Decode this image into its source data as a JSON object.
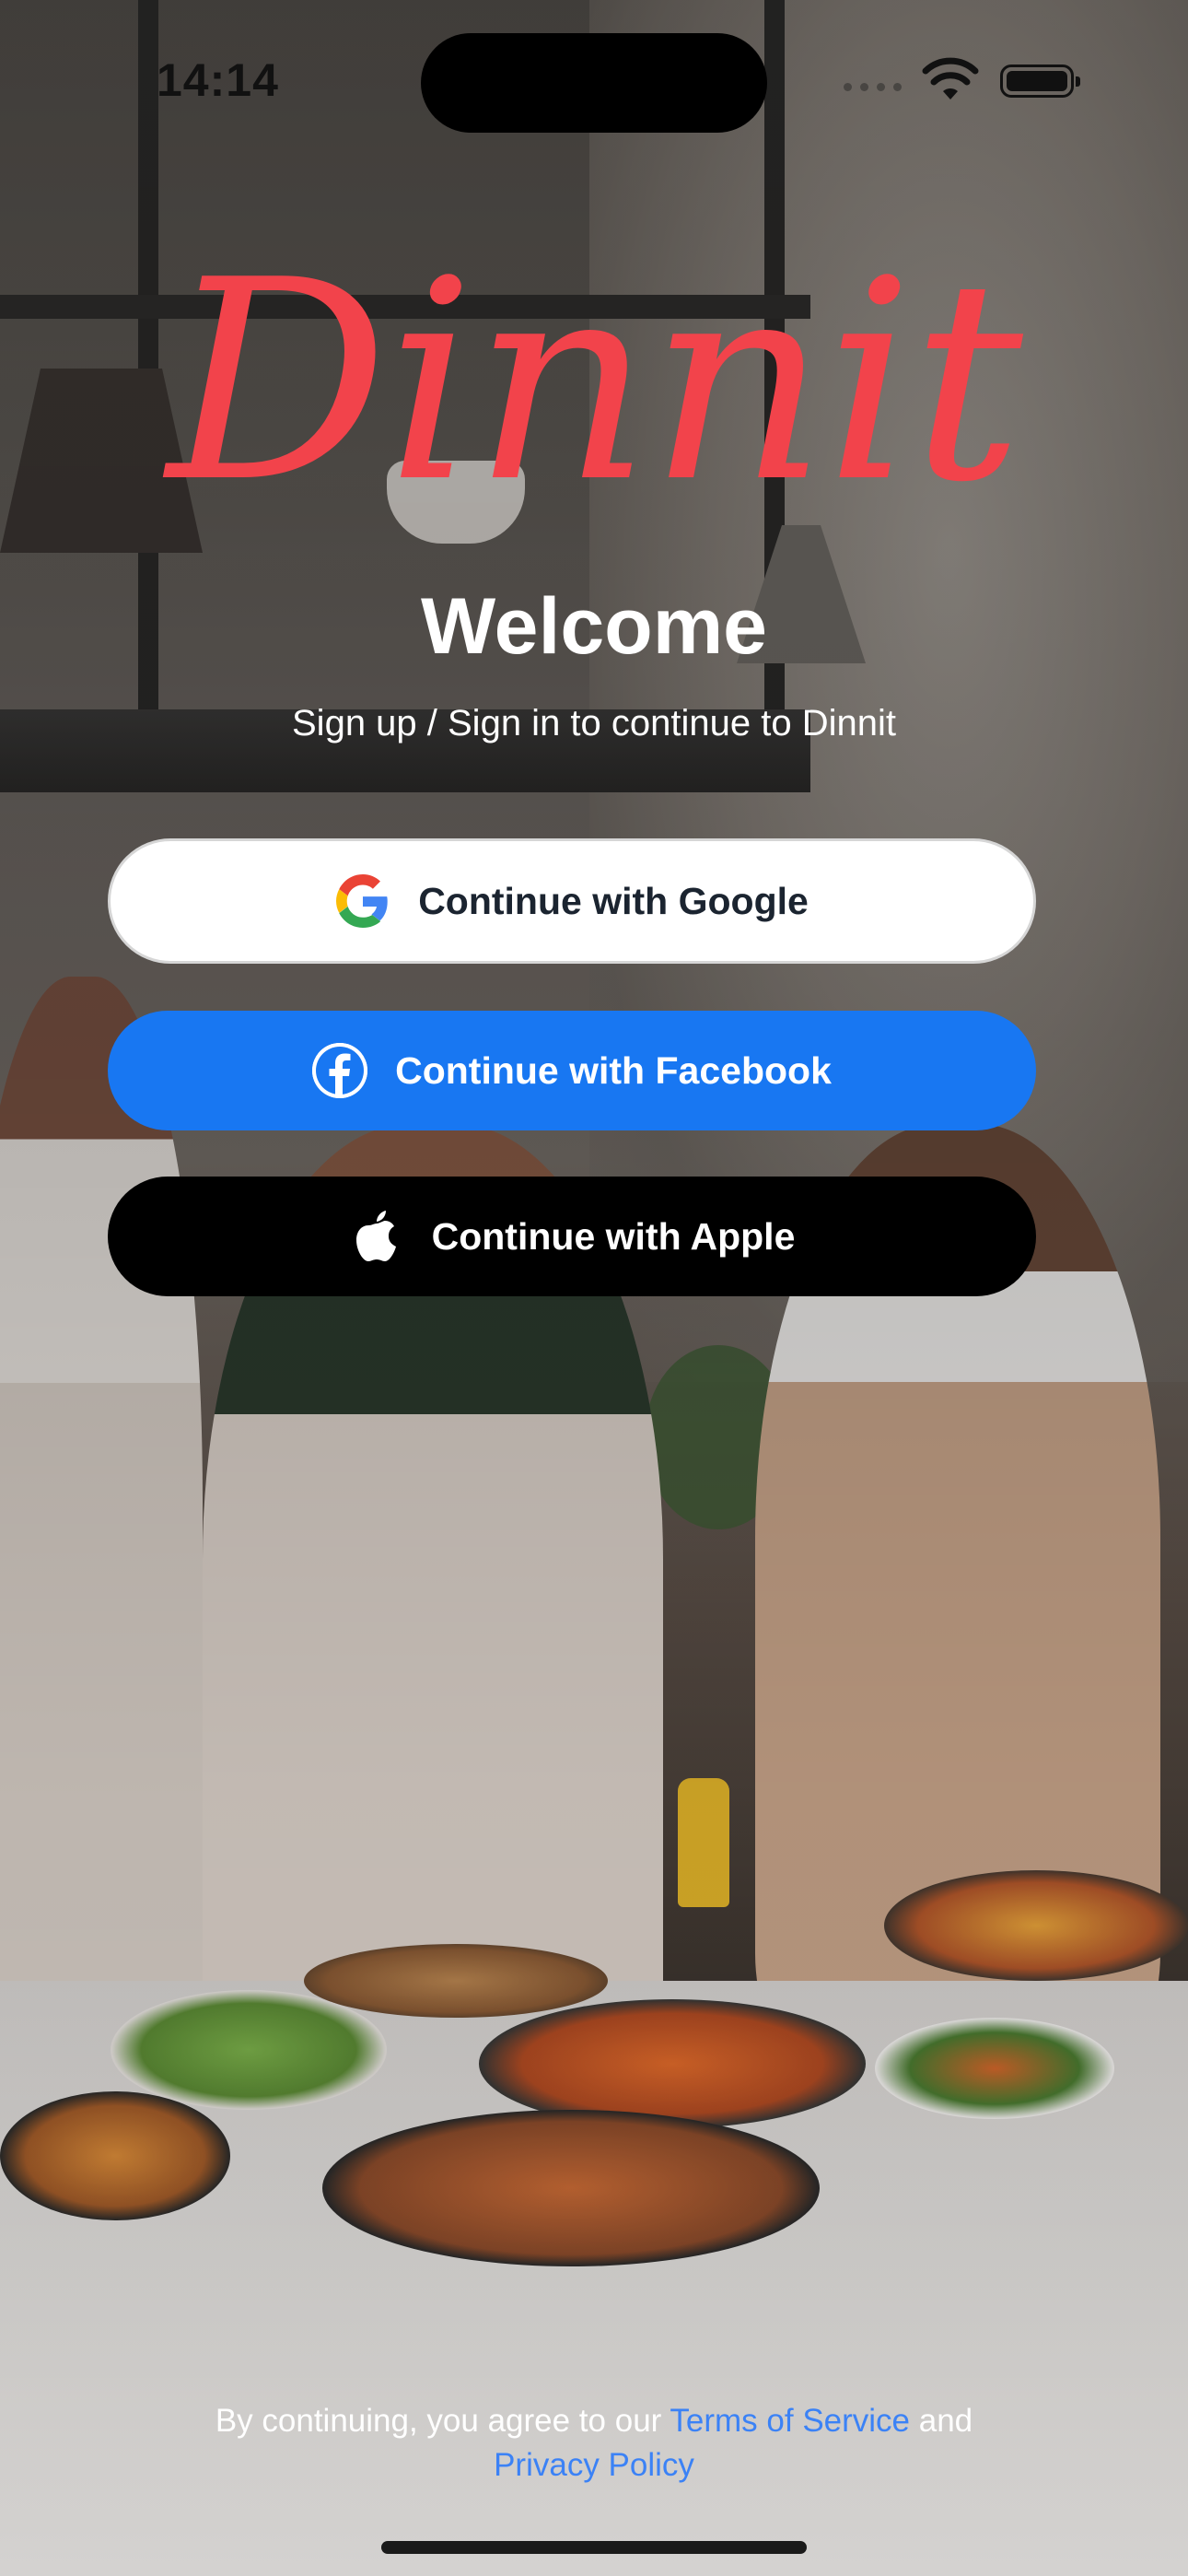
{
  "status_bar": {
    "time": "14:14"
  },
  "brand": {
    "logo_text": "Dinnit",
    "logo_color": "#f2434b"
  },
  "header": {
    "title": "Welcome",
    "subtitle": "Sign up / Sign in to continue to Dinnit"
  },
  "auth": {
    "google_label": "Continue with Google",
    "facebook_label": "Continue with Facebook",
    "apple_label": "Continue with Apple",
    "google_icon": "google-g-icon",
    "facebook_icon": "facebook-icon",
    "apple_icon": "apple-icon"
  },
  "footer": {
    "prefix": "By continuing, you agree to our ",
    "terms_link": "Terms of Service",
    "conjunction": " and",
    "privacy_link": "Privacy Policy"
  },
  "colors": {
    "facebook_blue": "#1877f2",
    "apple_black": "#000000",
    "link_blue": "#3b82f6"
  }
}
